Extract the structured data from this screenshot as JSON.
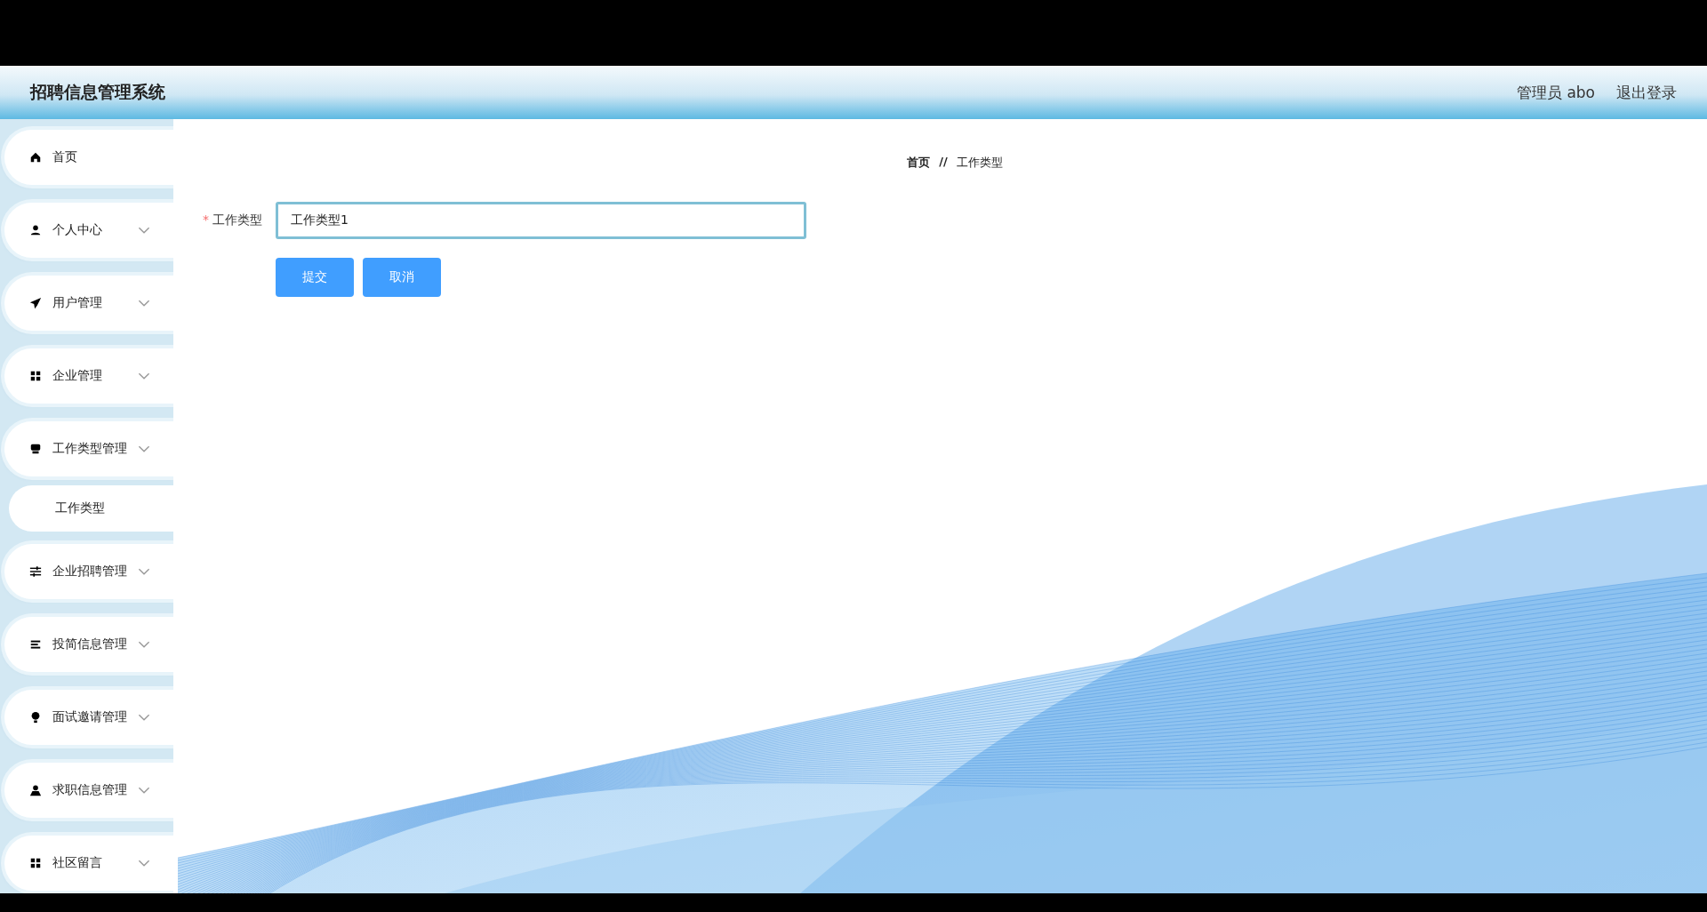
{
  "header": {
    "title": "招聘信息管理系统",
    "user": "管理员 abo",
    "logout": "退出登录"
  },
  "sidebar": {
    "items": [
      {
        "label": "首页",
        "kind": "link"
      },
      {
        "label": "个人中心",
        "kind": "submenu"
      },
      {
        "label": "用户管理",
        "kind": "submenu"
      },
      {
        "label": "企业管理",
        "kind": "submenu"
      },
      {
        "label": "工作类型管理",
        "kind": "submenu",
        "children": [
          {
            "label": "工作类型"
          }
        ]
      },
      {
        "label": "企业招聘管理",
        "kind": "submenu"
      },
      {
        "label": "投简信息管理",
        "kind": "submenu"
      },
      {
        "label": "面试邀请管理",
        "kind": "submenu"
      },
      {
        "label": "求职信息管理",
        "kind": "submenu"
      },
      {
        "label": "社区留言",
        "kind": "submenu"
      }
    ]
  },
  "breadcrumb": {
    "items": [
      "首页",
      "工作类型"
    ],
    "separator": "//"
  },
  "form": {
    "fields": [
      {
        "label": "工作类型",
        "required_mark": "*",
        "value": "工作类型1"
      }
    ],
    "buttons": [
      "提交",
      "取消"
    ]
  }
}
